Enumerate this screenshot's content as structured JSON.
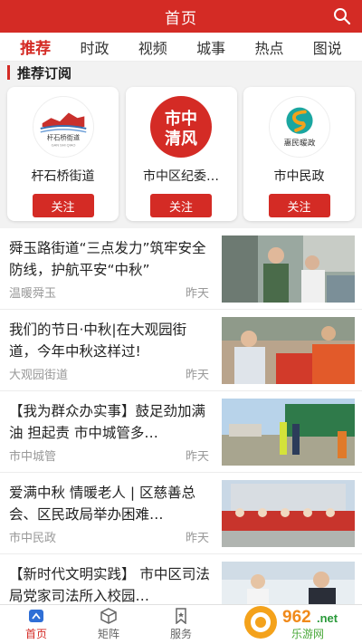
{
  "header": {
    "title": "首页"
  },
  "tabs": [
    {
      "label": "推荐",
      "active": true
    },
    {
      "label": "时政"
    },
    {
      "label": "视频"
    },
    {
      "label": "城事"
    },
    {
      "label": "热点"
    },
    {
      "label": "图说"
    }
  ],
  "section": {
    "title": "推荐订阅"
  },
  "subscriptions": [
    {
      "name": "杆石桥街道",
      "logo_text": "杆石桥街道",
      "logo_sub": "GAN SHI QIAO",
      "button": "关注"
    },
    {
      "name": "市中区纪委…",
      "logo_text": "市中清风",
      "button": "关注"
    },
    {
      "name": "市中民政",
      "logo_text": "惠民暖政",
      "button": "关注"
    }
  ],
  "news": [
    {
      "title": "舜玉路街道“三点发力”筑牢安全防线，护航平安“中秋”",
      "source": "温暖舜玉",
      "time": "昨天"
    },
    {
      "title": "我们的节日·中秋|在大观园街道，今年中秋这样过!",
      "source": "大观园街道",
      "time": "昨天"
    },
    {
      "title": "【我为群众办实事】鼓足劲加满油 担起责 市中城管多…",
      "source": "市中城管",
      "time": "昨天"
    },
    {
      "title": "爱满中秋 情暖老人 | 区慈善总会、区民政局举办困难…",
      "source": "市中民政",
      "time": "昨天"
    },
    {
      "title": "【新时代文明实践】 市中区司法局党家司法所入校园…",
      "source": "",
      "time": ""
    }
  ],
  "bottom_nav": [
    {
      "label": "首页",
      "icon": "home-icon",
      "active": true
    },
    {
      "label": "矩阵",
      "icon": "cube-icon"
    },
    {
      "label": "服务",
      "icon": "bookmark-icon"
    }
  ],
  "watermark": {
    "text": "962.net",
    "sub": "乐游网"
  },
  "colors": {
    "brand": "#d42b25",
    "background": "#f2f2f2"
  }
}
